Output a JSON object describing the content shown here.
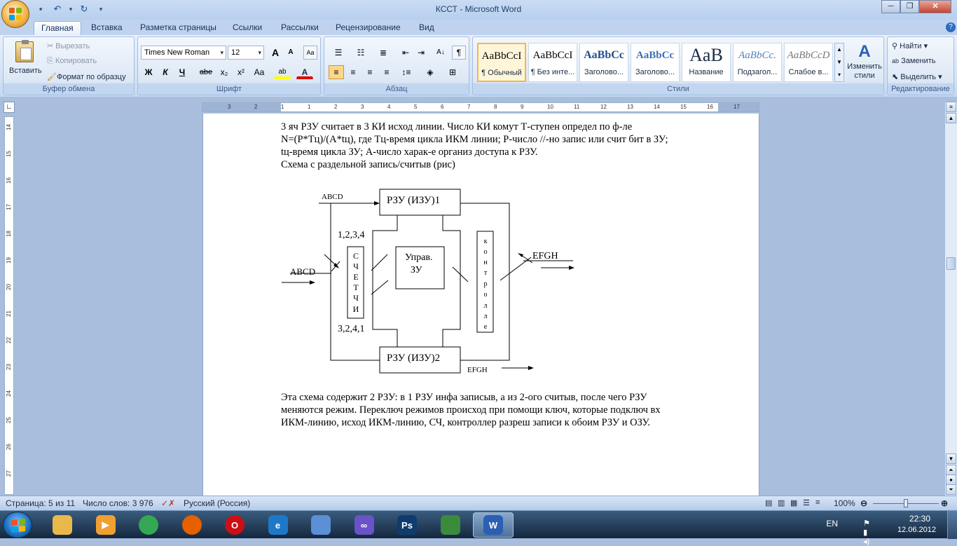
{
  "window": {
    "title": "КССТ - Microsoft Word",
    "qat": [
      "save-icon",
      "undo-icon",
      "redo-icon",
      "customize-icon"
    ]
  },
  "tabs": [
    "Главная",
    "Вставка",
    "Разметка страницы",
    "Ссылки",
    "Рассылки",
    "Рецензирование",
    "Вид"
  ],
  "ribbon": {
    "clipboard": {
      "label": "Буфер обмена",
      "paste": "Вставить",
      "cut": "Вырезать",
      "copy": "Копировать",
      "format_painter": "Формат по образцу"
    },
    "font": {
      "label": "Шрифт",
      "family": "Times New Roman",
      "size": "12",
      "grow": "A",
      "shrink": "A",
      "bold": "Ж",
      "italic": "К",
      "underline": "Ч",
      "strike": "abe",
      "sub": "x₂",
      "sup": "x²",
      "case": "Aa",
      "font_color": "A"
    },
    "paragraph": {
      "label": "Абзац",
      "pilcrow": "¶"
    },
    "styles": {
      "label": "Стили",
      "items": [
        {
          "preview": "AaBbCcI",
          "name": "¶ Обычный"
        },
        {
          "preview": "AaBbCcI",
          "name": "¶ Без инте..."
        },
        {
          "preview": "AaBbCc",
          "name": "Заголово..."
        },
        {
          "preview": "AaBbCc",
          "name": "Заголово..."
        },
        {
          "preview": "AaB",
          "name": "Название"
        },
        {
          "preview": "AaBbCc.",
          "name": "Подзагол..."
        },
        {
          "preview": "AaBbCcD",
          "name": "Слабое в..."
        }
      ],
      "change": "Изменить стили"
    },
    "editing": {
      "label": "Редактирование",
      "find": "Найти",
      "replace": "Заменить",
      "select": "Выделить"
    }
  },
  "ruler": {
    "h_ticks": [
      "3",
      "2",
      "1",
      "1",
      "2",
      "3",
      "4",
      "5",
      "6",
      "7",
      "8",
      "9",
      "10",
      "11",
      "12",
      "13",
      "14",
      "15",
      "16",
      "17"
    ],
    "v_ticks": [
      "14",
      "15",
      "16",
      "17",
      "18",
      "19",
      "20",
      "21",
      "22",
      "23",
      "24",
      "25",
      "26",
      "27"
    ]
  },
  "document": {
    "para1": [
      "3 яч РЗУ считает в 3 КИ исход линии. Число КИ комут Т-ступен определ по ф-ле",
      "N=(P*Tц)/(A*tц), где Tц-время цикла ИКМ линии; P-число //-но запис или счит бит в ЗУ;",
      "tц-время цикла ЗУ; А-число харак-е организ доступа к РЗУ.",
      "Схема с раздельной запись/считыв (рис)"
    ],
    "diagram": {
      "rzu1": "РЗУ (ИЗУ)1",
      "rzu2": "РЗУ (ИЗУ)2",
      "abcd_top": "ABCD",
      "abcd_left": "ABCD",
      "efgh_right": "EFGH",
      "efgh_bottom": "EFGH",
      "seq_top": "1,2,3,4",
      "seq_bottom": "3,2,4,1",
      "upr_line1": "Управ.",
      "upr_line2": "ЗУ",
      "counter_letters": [
        "С",
        "Ч",
        "Е",
        "Т",
        "Ч",
        "И"
      ],
      "controller_letters": [
        "к",
        "о",
        "н",
        "т",
        "р",
        "о",
        "л",
        "л",
        "е"
      ]
    },
    "para2": [
      "Эта схема содержит 2 РЗУ: в 1 РЗУ инфа записыв, а из 2-ого считыв, после чего РЗУ",
      "меняются режим. Переключ режимов происход при помощи ключ, которые подключ вх",
      "ИКМ-линию, исход ИКМ-линию, СЧ, контроллер разреш записи к обоим РЗУ и ОЗУ."
    ]
  },
  "status": {
    "page": "Страница: 5 из 11",
    "words": "Число слов: 3 976",
    "language": "Русский (Россия)",
    "zoom": "100%"
  },
  "taskbar": {
    "apps": [
      {
        "name": "explorer",
        "label": "",
        "color": "#e8b94a"
      },
      {
        "name": "media",
        "label": "▶",
        "color": "#f0a030"
      },
      {
        "name": "chrome",
        "label": "",
        "color": "#34a853"
      },
      {
        "name": "firefox",
        "label": "",
        "color": "#e66000"
      },
      {
        "name": "opera",
        "label": "O",
        "color": "#cc0f16"
      },
      {
        "name": "ie",
        "label": "e",
        "color": "#1e78c8"
      },
      {
        "name": "search",
        "label": "",
        "color": "#5b8fd6"
      },
      {
        "name": "loop",
        "label": "∞",
        "color": "#6a52c8"
      },
      {
        "name": "photoshop",
        "label": "Ps",
        "color": "#0f3c6e"
      },
      {
        "name": "calc",
        "label": "",
        "color": "#3c8a3c"
      },
      {
        "name": "word",
        "label": "W",
        "color": "#2b5fb4"
      }
    ],
    "lang": "EN",
    "time": "22:30",
    "date": "12.06.2012"
  }
}
